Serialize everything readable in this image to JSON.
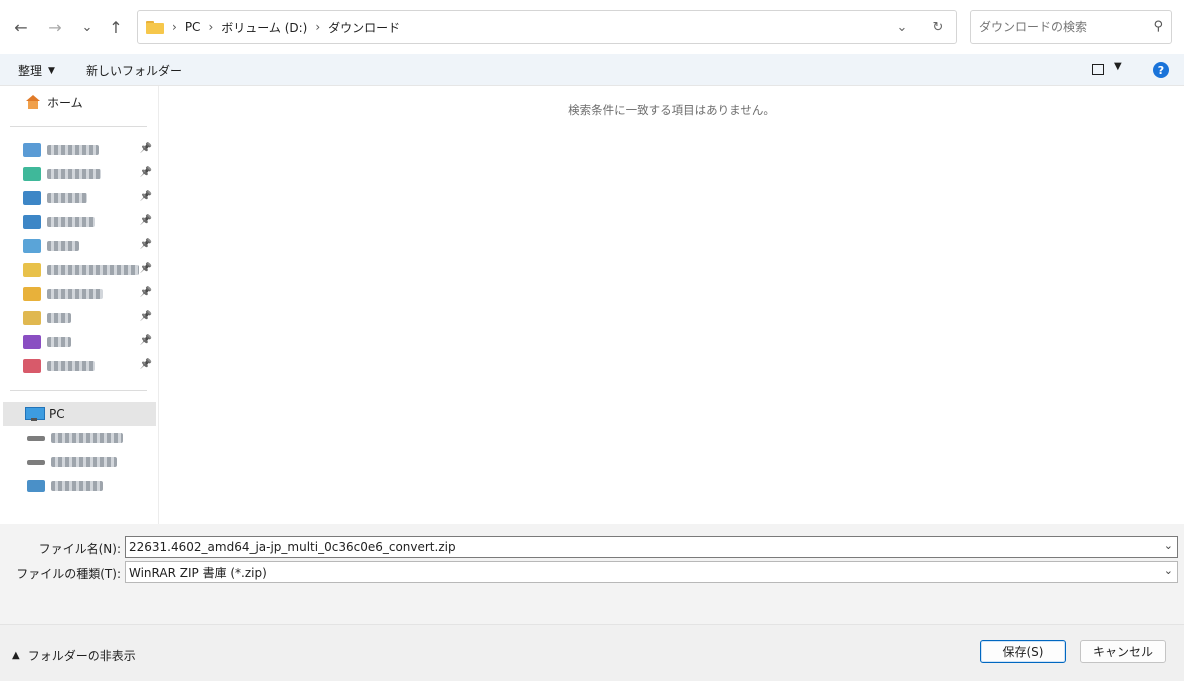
{
  "nav": {
    "back": "←",
    "forward": "→",
    "recent": "⌄",
    "up": "↑"
  },
  "address": {
    "segments": [
      "PC",
      "ボリューム (D:)",
      "ダウンロード"
    ],
    "separator": "›"
  },
  "search": {
    "placeholder": "ダウンロードの検索"
  },
  "command_bar": {
    "organize": "整理",
    "new_folder": "新しいフォルダー"
  },
  "sidebar": {
    "home": "ホーム",
    "pc": "PC",
    "quick_access_colors": [
      "#5a9bd5",
      "#3fb89a",
      "#3d86c6",
      "#3d86c6",
      "#5aa4d8",
      "#e8c14a",
      "#e8b13a",
      "#e0b850",
      "#8a4ec2",
      "#d85a6a"
    ],
    "drive_colors": [
      "#7d7d7d",
      "#7d7d7d",
      "#4a90c8"
    ]
  },
  "content": {
    "empty_message": "検索条件に一致する項目はありません。"
  },
  "form": {
    "filename_label": "ファイル名(N):",
    "filename_value": "22631.4602_amd64_ja-jp_multi_0c36c0e6_convert.zip",
    "filetype_label": "ファイルの種類(T):",
    "filetype_value": "WinRAR ZIP 書庫 (*.zip)"
  },
  "footer": {
    "hide_folders": "フォルダーの非表示",
    "save": "保存(S)",
    "cancel": "キャンセル"
  }
}
